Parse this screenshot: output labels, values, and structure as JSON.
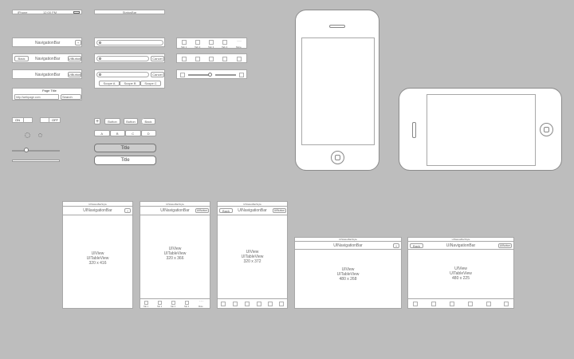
{
  "statusbar": {
    "carrier": "iPhone",
    "time": "12:00 PM",
    "battery": "100%",
    "label": "StatusBar"
  },
  "navbars": {
    "nav1_title": "NavigationBar",
    "nav1_plus": "+",
    "nav2_title": "NavigationBar",
    "nav2_back": "Back",
    "nav2_right": "UIButton",
    "nav3_title": "NavigationBar",
    "nav3_right": "UIButton",
    "page_title": "Page Title",
    "url": "http://webpage.com",
    "search_btn": "Search"
  },
  "searchbars": {
    "cancel1": "Cancel",
    "cancel2": "Cancel",
    "scopes": [
      "Scope A",
      "Scope B",
      "Scope C"
    ]
  },
  "tabbar": {
    "items": [
      "Tab 1",
      "Tab 2",
      "Tab 3",
      "Tab 4",
      "More"
    ]
  },
  "switches": {
    "on": "ON",
    "off": "OFF"
  },
  "buttons": {
    "plus": "+",
    "button1": "Button",
    "button2": "Button",
    "back": "Back"
  },
  "segmented": [
    "A",
    "B",
    "C",
    "D"
  ],
  "title_buttons": [
    "Title",
    "Title"
  ],
  "screens": [
    {
      "status": "UIStatusBarStyle",
      "nav": "UINavigationBar",
      "nav_right": "+",
      "body": [
        "UIView",
        "UITableView",
        "320 x 416"
      ]
    },
    {
      "status": "UIStatusBarStyle",
      "nav": "UINavigationBar",
      "nav_right": "UIButton",
      "body": [
        "UIView",
        "UITableView",
        "320 x 366"
      ],
      "tabs": [
        "Tab 1",
        "Tab 2",
        "Tab 3",
        "Tab 4",
        "More"
      ]
    },
    {
      "status": "UIStatusBarStyle",
      "nav": "UINavigationBar",
      "nav_left": "Back",
      "nav_right": "UIButton",
      "body": [
        "UIView",
        "UITableView",
        "320 x 372"
      ]
    },
    {
      "status": "UIStatusBarStyle",
      "nav": "UINavigationBar",
      "nav_right": "+",
      "body": [
        "UIView",
        "UITableView",
        "480 x 268"
      ]
    },
    {
      "status": "UIStatusBarStyle",
      "nav": "UINavigationBar",
      "nav_left": "Back",
      "nav_right": "UIButton",
      "body": [
        "UIView",
        "UITableView",
        "480 x 225"
      ]
    }
  ]
}
